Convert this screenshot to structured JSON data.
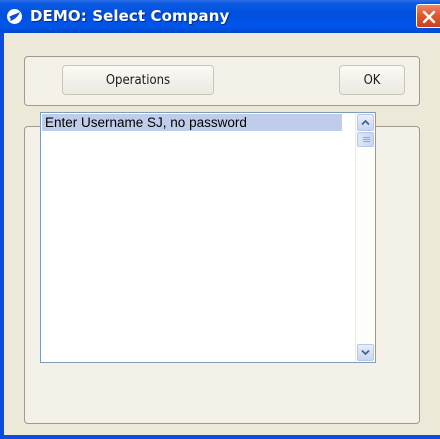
{
  "window": {
    "title": "DEMO: Select Company",
    "icons": {
      "app": "app-logo-icon",
      "close": "close-icon"
    },
    "colors": {
      "titlebar": "#0050e0",
      "close": "#e25a2f",
      "dialog_bg": "#ede9d8",
      "selection": "#c0cdea"
    }
  },
  "toolbar": {
    "operations_label": "Operations",
    "ok_label": "OK"
  },
  "company_list": {
    "items": [
      {
        "label": "Enter Username SJ, no password",
        "selected": true
      }
    ],
    "scrollbar": {
      "up_icon": "chevron-up-icon",
      "down_icon": "chevron-down-icon"
    }
  }
}
